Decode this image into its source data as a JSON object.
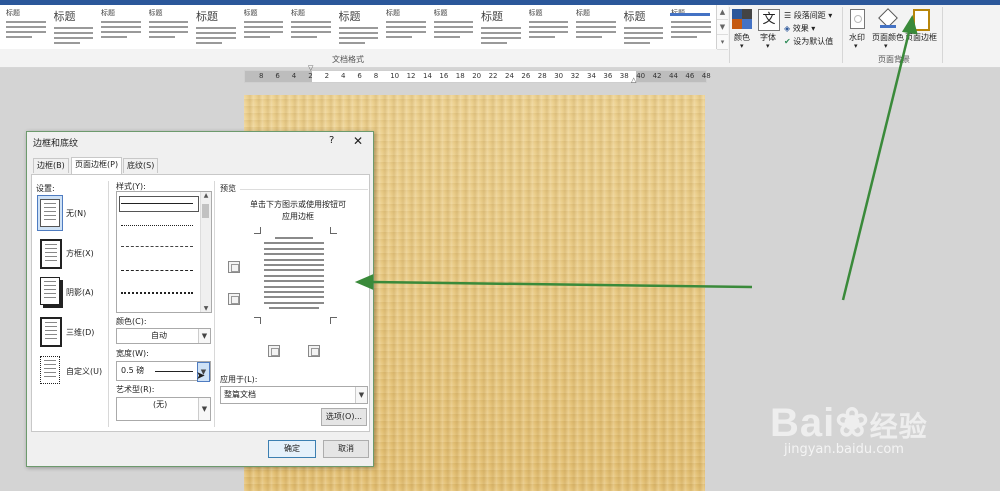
{
  "ribbon": {
    "gallery_titles": [
      "标题",
      "标题",
      "标题",
      "标题",
      "标题",
      "标题",
      "标题",
      "标题",
      "标题",
      "标题",
      "标题",
      "标题",
      "标题",
      "标题",
      "标题"
    ],
    "group_label": "文档格式",
    "colors_label": "颜色",
    "fonts_label": "字体",
    "paragraph_spacing_label": "段落间距",
    "effects_label": "效果",
    "set_default_label": "设为默认值",
    "watermark_label": "水印",
    "page_color_label": "页面颜色",
    "page_borders_label": "页面边框",
    "page_bg_group_label": "页面背景"
  },
  "ruler": {
    "ticks": [
      "8",
      "6",
      "4",
      "2",
      "2",
      "4",
      "6",
      "8",
      "10",
      "12",
      "14",
      "16",
      "18",
      "20",
      "22",
      "24",
      "26",
      "28",
      "30",
      "32",
      "34",
      "36",
      "38",
      "40",
      "42",
      "44",
      "46",
      "48"
    ]
  },
  "dialog": {
    "title": "边框和底纹",
    "help": "?",
    "close": "✕",
    "tabs": [
      "边框(B)",
      "页面边框(P)",
      "底纹(S)"
    ],
    "settings_label": "设置:",
    "settings": [
      "无(N)",
      "方框(X)",
      "阴影(A)",
      "三维(D)",
      "自定义(U)"
    ],
    "style_label": "样式(Y):",
    "color_label": "颜色(C):",
    "color_value": "自动",
    "width_label": "宽度(W):",
    "width_value": "0.5 磅",
    "art_label": "艺术型(R):",
    "art_value": "(无)",
    "preview_label": "预览",
    "preview_hint": "单击下方图示或使用按钮可应用边框",
    "apply_to_label": "应用于(L):",
    "apply_to_value": "整篇文档",
    "options_button": "选项(O)...",
    "ok_button": "确定",
    "cancel_button": "取消"
  },
  "watermark": {
    "brand": "Bai",
    "brand_cn": "经验",
    "url": "jingyan.baidu.com"
  },
  "colors": {
    "accent": "#2b579a",
    "arrow": "#3a8a3a",
    "page_bg": "#e8c77e"
  }
}
